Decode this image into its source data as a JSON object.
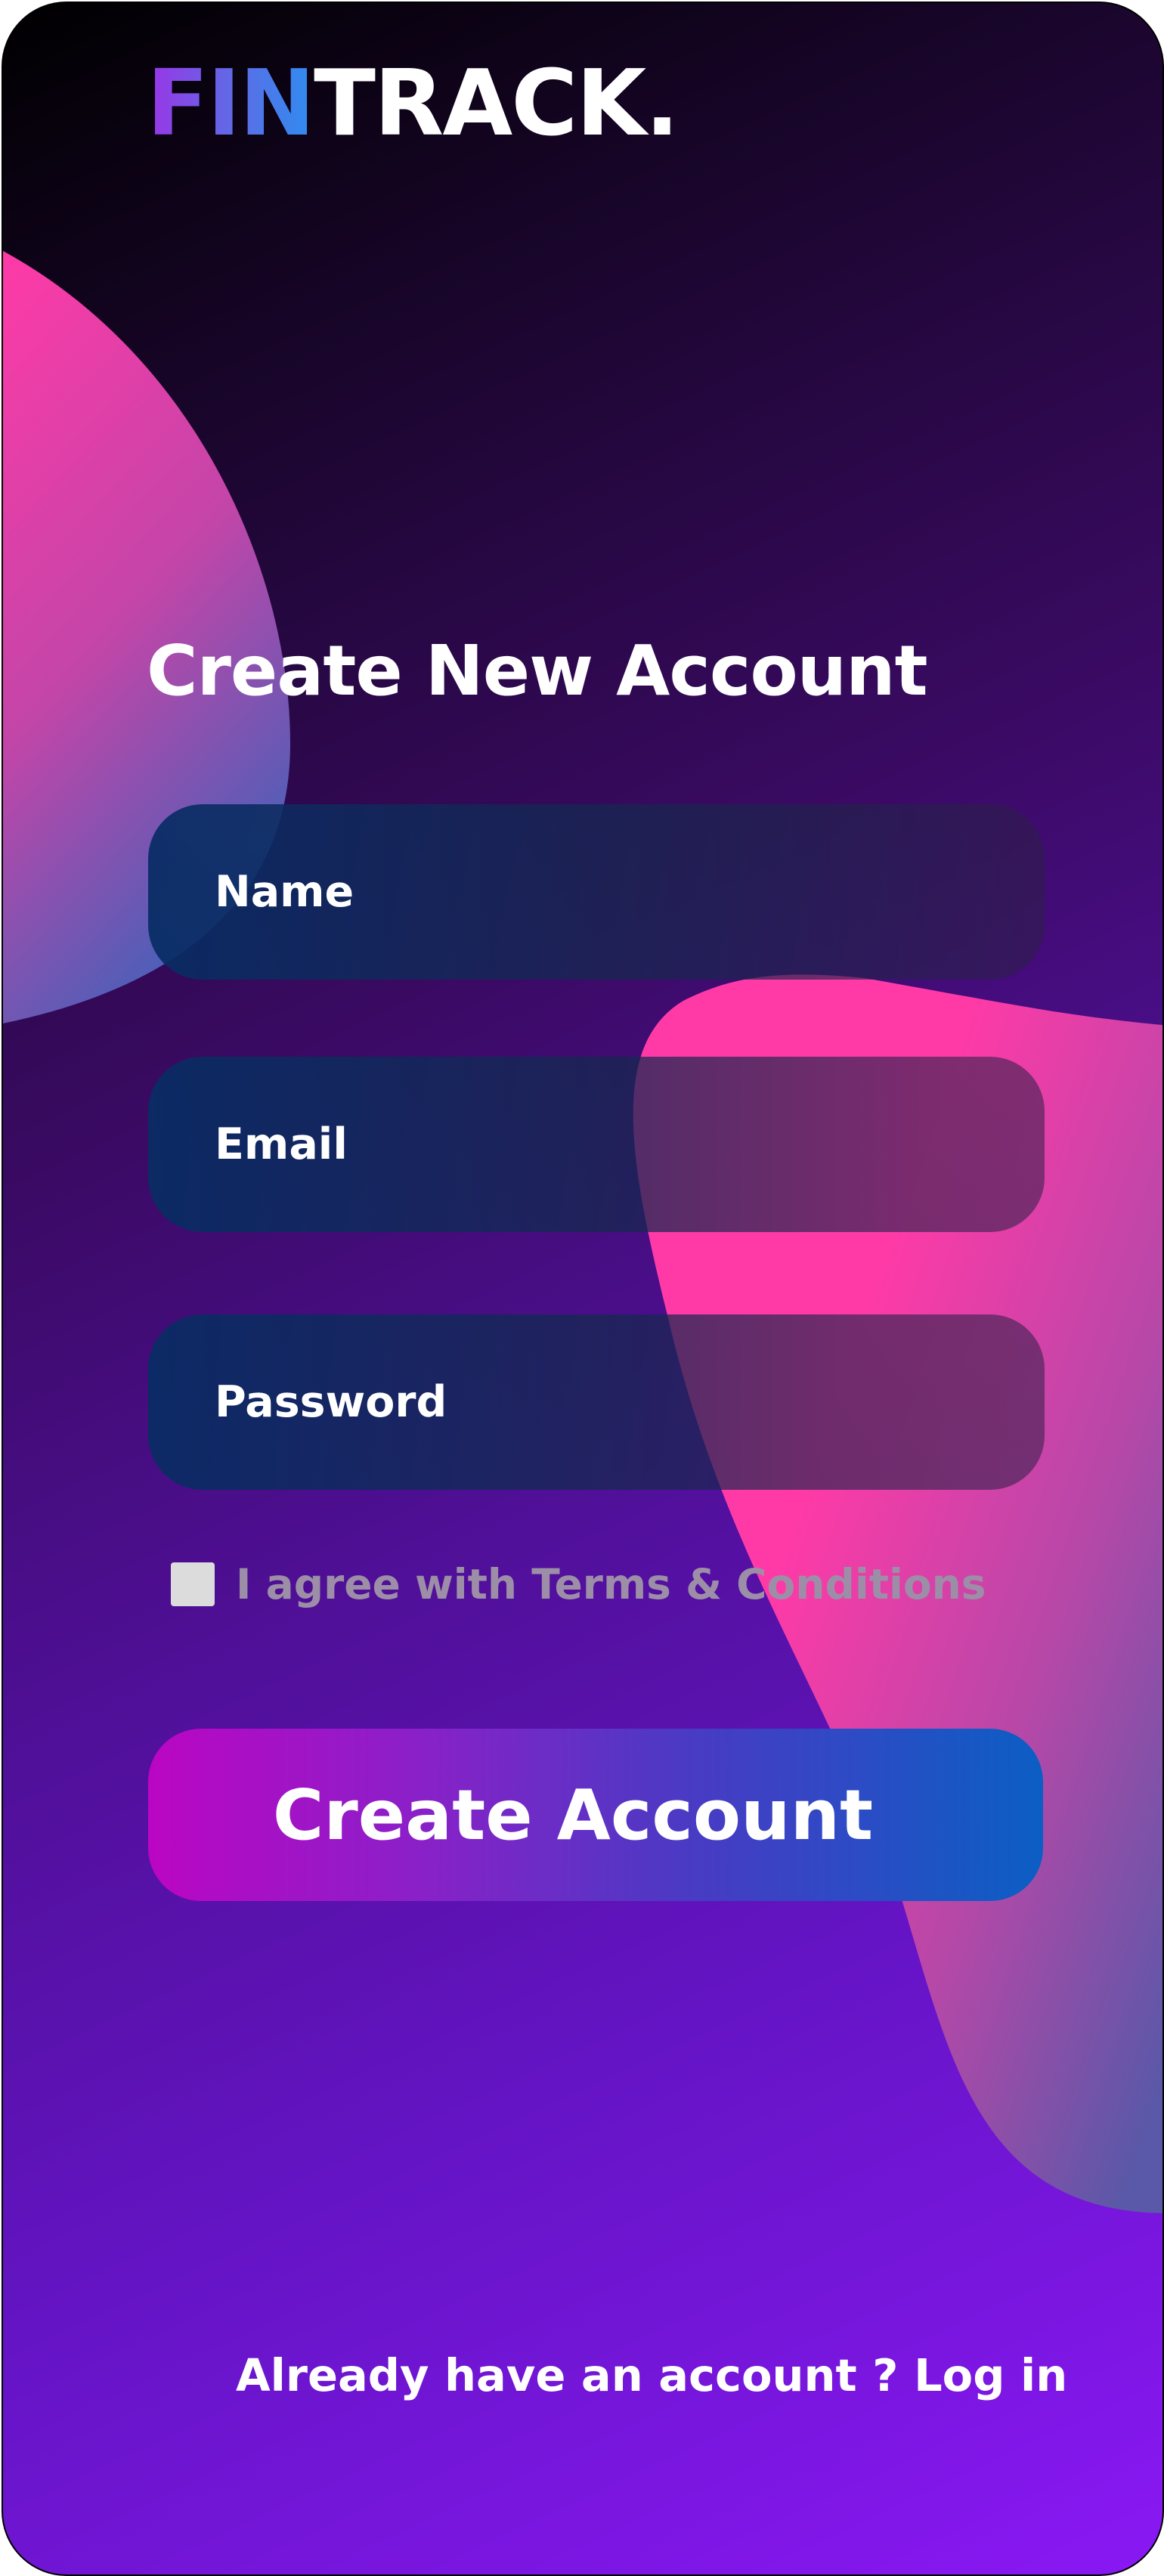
{
  "brand": {
    "part1": "FIN",
    "part2": "TRACK."
  },
  "form": {
    "title": "Create New Account",
    "fields": {
      "name_placeholder": "Name",
      "email_placeholder": "Email",
      "password_placeholder": "Password"
    },
    "terms_label": "I agree with Terms & Conditions",
    "terms_checked": false,
    "submit_label": "Create Account"
  },
  "footer": {
    "prompt": "Already have an account ?",
    "login_link": "Log in"
  },
  "colors": {
    "accent_pink": "#ff3aa7",
    "accent_blue": "#0b5ec4",
    "background_end": "#8a18f4"
  }
}
